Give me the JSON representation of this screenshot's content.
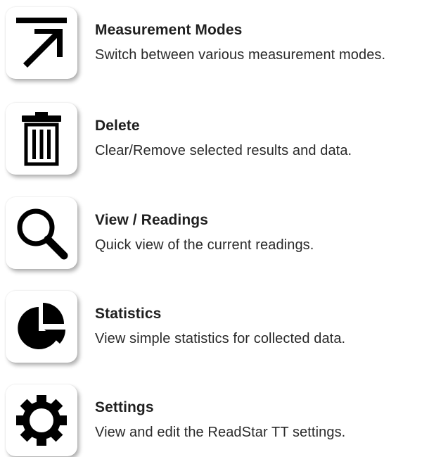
{
  "items": [
    {
      "icon": "arrow-up-right-icon",
      "title": "Measurement Modes",
      "description": "Switch between various measurement modes."
    },
    {
      "icon": "trash-icon",
      "title": "Delete",
      "description": "Clear/Remove selected results and data."
    },
    {
      "icon": "magnifier-icon",
      "title": "View / Readings",
      "description": "Quick view of the current readings."
    },
    {
      "icon": "pie-chart-icon",
      "title": "Statistics",
      "description": "View simple statistics for collected data."
    },
    {
      "icon": "gear-icon",
      "title": "Settings",
      "description": "View and edit the ReadStar TT settings."
    }
  ]
}
